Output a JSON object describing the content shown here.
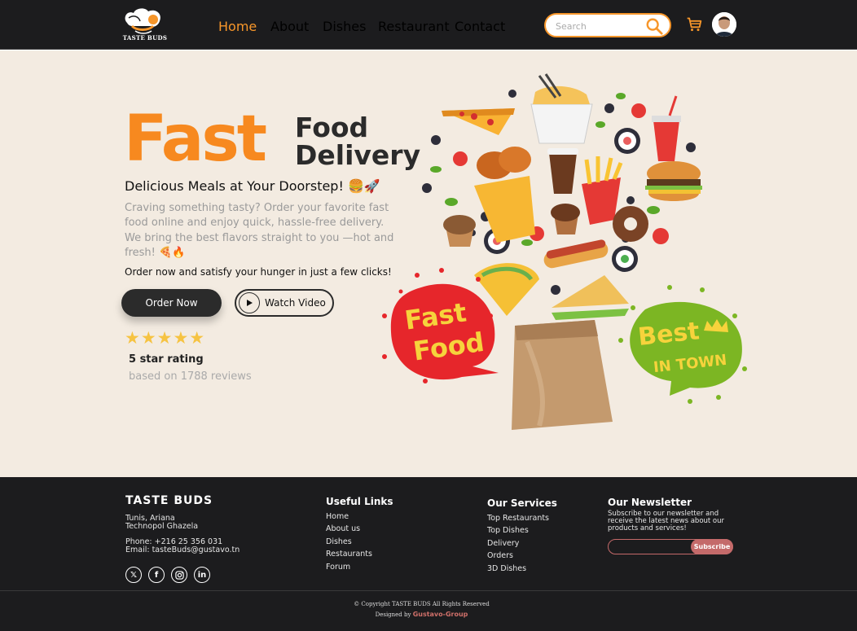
{
  "brand": {
    "logo_text": "TASTE BUDS"
  },
  "nav": {
    "items": [
      {
        "label": "Home",
        "active": true
      },
      {
        "label": "About"
      },
      {
        "label": "Dishes"
      },
      {
        "label": "Restaurant"
      },
      {
        "label": "Contact"
      }
    ],
    "search_placeholder": "Search",
    "accent": "#f7962a"
  },
  "hero": {
    "headline_big": "Fast",
    "headline_line1": "Food",
    "headline_line2": "Delivery",
    "tagline": "Delicious Meals at Your Doorstep! 🍔🚀",
    "description": "Craving something tasty? Order your favorite fast food online and enjoy quick, hassle-free delivery. We bring the best flavors straight to you —hot and fresh! 🍕🔥",
    "cta_line": "Order now and satisfy your hunger in just a few clicks!",
    "order_button": "Order Now",
    "watch_button": "Watch Video",
    "stars": "★★★★★",
    "rating_title": "5 star rating",
    "rating_sub": "based on 1788 reviews",
    "badge_left": [
      "Fast",
      "Food"
    ],
    "badge_right": [
      "Best",
      "IN TOWN"
    ]
  },
  "footer": {
    "brand": "TASTE  BUDS",
    "address_line1": "Tunis, Ariana",
    "address_line2": "Technopol Ghazela",
    "phone": "Phone: +216 25 356 031",
    "email": "Email: tasteBuds@gustavo.tn",
    "useful_links_title": "Useful Links",
    "useful_links": [
      "Home",
      "About us",
      "Dishes",
      "Restaurants",
      "Forum"
    ],
    "services_title": "Our Services",
    "services": [
      "Top Restaurants",
      "Top Dishes",
      "Delivery",
      "Orders",
      "3D Dishes"
    ],
    "newsletter_title": "Our Newsletter",
    "newsletter_desc": "Subscribe to our newsletter and receive the latest news about our products and services!",
    "subscribe_button": "Subscribe",
    "copyright": "© Copyright TASTE BUDS All Rights Reserved",
    "designed_by_prefix": "Designed by ",
    "designed_by_name": "Gustavo-Group"
  }
}
